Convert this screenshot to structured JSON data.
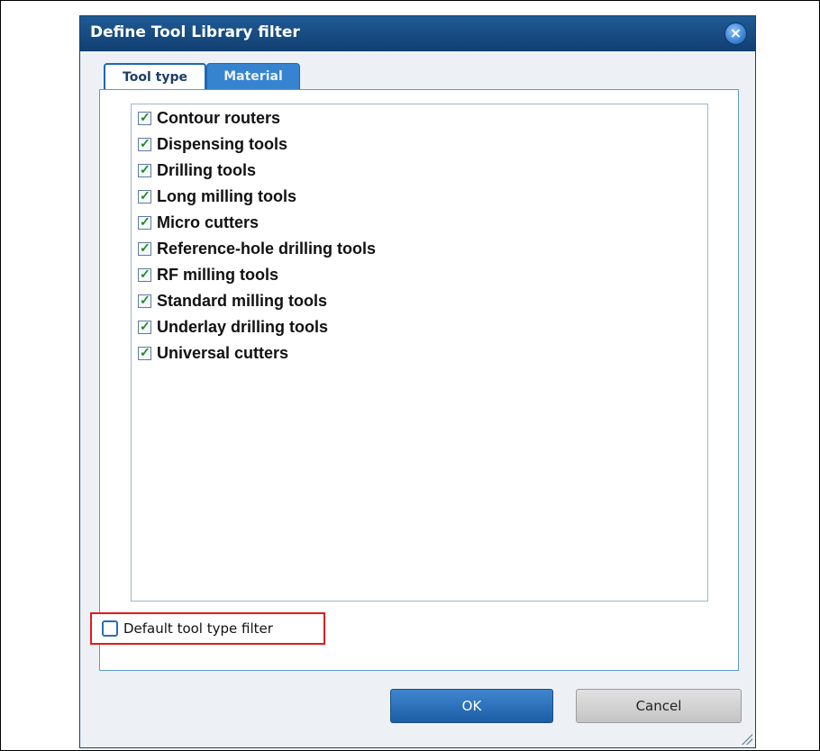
{
  "dialog": {
    "title": "Define Tool Library filter",
    "close_icon_glyph": "×"
  },
  "tabs": [
    {
      "label": "Tool type",
      "active": true
    },
    {
      "label": "Material",
      "active": false
    }
  ],
  "tool_types": [
    {
      "label": "Contour routers",
      "checked": true
    },
    {
      "label": "Dispensing tools",
      "checked": true
    },
    {
      "label": "Drilling tools",
      "checked": true
    },
    {
      "label": "Long milling tools",
      "checked": true
    },
    {
      "label": "Micro cutters",
      "checked": true
    },
    {
      "label": "Reference-hole drilling tools",
      "checked": true
    },
    {
      "label": "RF milling tools",
      "checked": true
    },
    {
      "label": "Standard milling tools",
      "checked": true
    },
    {
      "label": "Underlay drilling tools",
      "checked": true
    },
    {
      "label": "Universal cutters",
      "checked": true
    }
  ],
  "check_glyph": "✓",
  "default_filter": {
    "label": "Default tool type filter",
    "checked": false
  },
  "buttons": {
    "ok": "OK",
    "cancel": "Cancel"
  }
}
